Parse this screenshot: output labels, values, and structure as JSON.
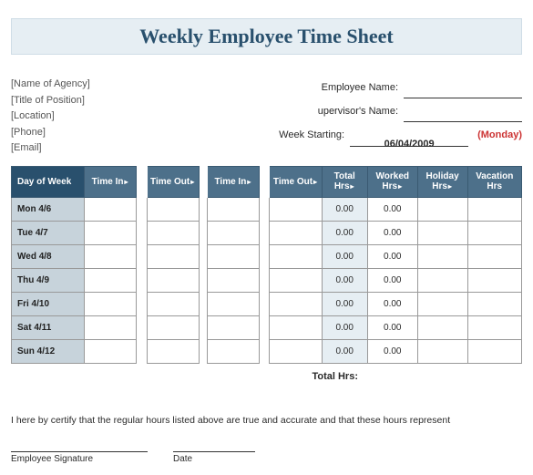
{
  "title": "Weekly Employee Time Sheet",
  "agency_placeholders": {
    "agency": "[Name of Agency]",
    "position": "[Title of Position]",
    "location": "[Location]",
    "phone": "[Phone]",
    "email": "[Email]"
  },
  "labels": {
    "employee_name": "Employee Name:",
    "supervisor_name": "upervisor's Name:",
    "week_starting": "Week Starting:",
    "total_hrs": "Total Hrs:",
    "certify": "I here by certify that the regular hours listed above are true and accurate and that these hours represent",
    "employee_signature": "Employee Signature",
    "date": "Date"
  },
  "week_start_value": "06/04/2009",
  "week_start_day": "(Monday)",
  "columns": {
    "day": "Day of Week",
    "time_in": "Time In",
    "time_out": "Time Out",
    "time_in2": "Time In",
    "time_out2": "Time Out",
    "total_hrs": "Total Hrs",
    "worked_hrs": "Worked Hrs",
    "holiday_hrs": "Holiday Hrs",
    "vacation_hrs": "Vacation Hrs"
  },
  "rows": [
    {
      "day": "Mon 4/6",
      "total": "0.00",
      "worked": "0.00"
    },
    {
      "day": "Tue 4/7",
      "total": "0.00",
      "worked": "0.00"
    },
    {
      "day": "Wed 4/8",
      "total": "0.00",
      "worked": "0.00"
    },
    {
      "day": "Thu 4/9",
      "total": "0.00",
      "worked": "0.00"
    },
    {
      "day": "Fri 4/10",
      "total": "0.00",
      "worked": "0.00"
    },
    {
      "day": "Sat 4/11",
      "total": "0.00",
      "worked": "0.00"
    },
    {
      "day": "Sun 4/12",
      "total": "0.00",
      "worked": "0.00"
    }
  ]
}
